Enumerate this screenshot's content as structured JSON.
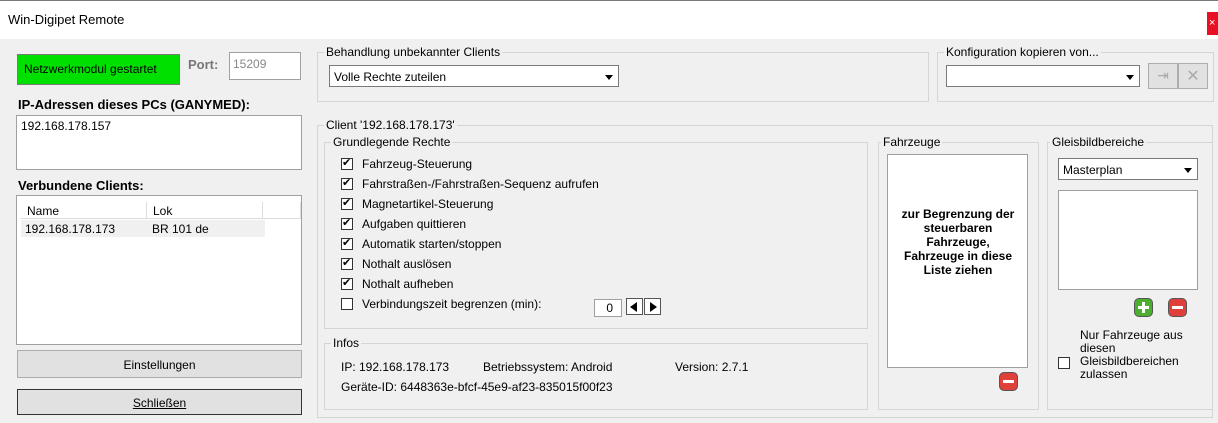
{
  "window": {
    "title": "Win-Digipet Remote",
    "close_label": "×"
  },
  "left": {
    "status": "Netzwerkmodul gestartet",
    "port_label": "Port:",
    "port_value": "15209",
    "ip_heading": "IP-Adressen dieses PCs (GANYMED):",
    "ip_list": [
      "192.168.178.157"
    ],
    "clients_heading": "Verbundene Clients:",
    "clients_columns": [
      "Name",
      "Lok"
    ],
    "clients_rows": [
      {
        "name": "192.168.178.173",
        "lok": "BR 101 de"
      }
    ],
    "settings_button": "Einstellungen",
    "close_button": "Schließen"
  },
  "unknown_clients": {
    "label": "Behandlung unbekannter Clients",
    "value": "Volle Rechte zuteilen"
  },
  "copy_config": {
    "label": "Konfiguration kopieren von...",
    "value": ""
  },
  "client": {
    "label": "Client '192.168.178.173'",
    "rights_label": "Grundlegende Rechte",
    "rights": [
      {
        "label": "Fahrzeug-Steuerung",
        "checked": true
      },
      {
        "label": "Fahrstraßen-/Fahrstraßen-Sequenz aufrufen",
        "checked": true
      },
      {
        "label": "Magnetartikel-Steuerung",
        "checked": true
      },
      {
        "label": "Aufgaben quittieren",
        "checked": true
      },
      {
        "label": "Automatik starten/stoppen",
        "checked": true
      },
      {
        "label": "Nothalt auslösen",
        "checked": true
      },
      {
        "label": "Nothalt aufheben",
        "checked": true
      },
      {
        "label": "Verbindungszeit begrenzen (min):",
        "checked": false
      }
    ],
    "time_value": "0",
    "infos_label": "Infos",
    "ip_info": "IP: 192.168.178.173",
    "os_info": "Betriebssystem: Android",
    "version_info": "Version: 2.7.1",
    "device_info": "Geräte-ID: 6448363e-bfcf-45e9-af23-835015f00f23",
    "vehicles_label": "Fahrzeuge",
    "vehicles_hint": "zur Begrenzung der steuerbaren Fahrzeuge, Fahrzeuge in diese Liste ziehen",
    "areas_label": "Gleisbildbereiche",
    "areas_value": "Masterplan",
    "areas_only_label": "Nur Fahrzeuge aus diesen Gleisbildbereichen zulassen",
    "areas_only_checked": false
  },
  "colors": {
    "status_green": "#00e000",
    "close_red": "#e81123"
  }
}
